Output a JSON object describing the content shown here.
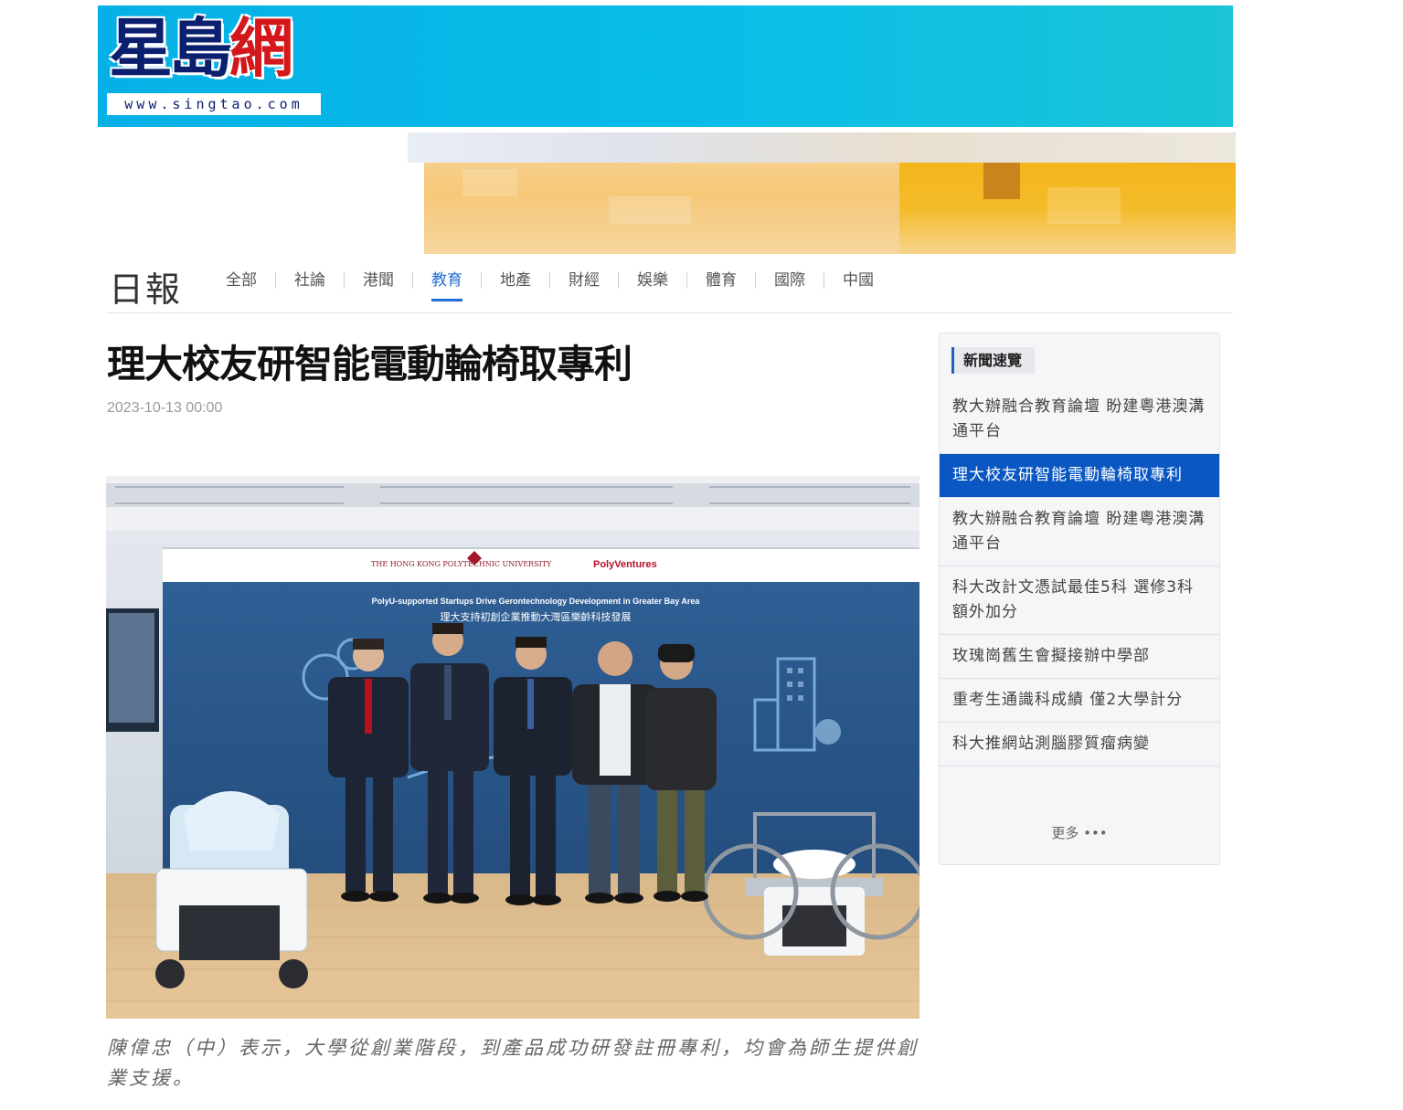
{
  "header": {
    "logo_text_1": "星島",
    "logo_text_2": "網",
    "logo_url": "www.singtao.com"
  },
  "nav": {
    "title": "日報",
    "items": [
      {
        "label": "全部",
        "active": false
      },
      {
        "label": "社論",
        "active": false
      },
      {
        "label": "港聞",
        "active": false
      },
      {
        "label": "教育",
        "active": true
      },
      {
        "label": "地產",
        "active": false
      },
      {
        "label": "財經",
        "active": false
      },
      {
        "label": "娛樂",
        "active": false
      },
      {
        "label": "體育",
        "active": false
      },
      {
        "label": "國際",
        "active": false
      },
      {
        "label": "中國",
        "active": false
      }
    ]
  },
  "article": {
    "headline": "理大校友研智能電動輪椅取專利",
    "date": "2023-10-13 00:00",
    "photo": {
      "backdrop_title_en": "PolyU-supported Startups Drive Gerontechnology Development in Greater Bay Area",
      "backdrop_title_zh": "理大支持初創企業推動大灣區樂齡科技發展",
      "backdrop_logo_1": "THE HONG KONG POLYTECHNIC UNIVERSITY",
      "backdrop_logo_2": "PolyVentures"
    },
    "caption": "陳偉忠（中）表示，大學從創業階段，到產品成功研發註冊專利，均會為師生提供創業支援。"
  },
  "sidebar": {
    "heading": "新聞速覽",
    "items": [
      {
        "text": "教大辦融合教育論壇 盼建粵港澳溝通平台",
        "active": false
      },
      {
        "text": "理大校友研智能電動輪椅取專利",
        "active": true
      },
      {
        "text": "教大辦融合教育論壇 盼建粵港澳溝通平台",
        "active": false
      },
      {
        "text": "科大改計文憑試最佳5科 選修3科額外加分",
        "active": false
      },
      {
        "text": "玫瑰崗舊生會擬接辦中學部",
        "active": false
      },
      {
        "text": "重考生通識科成績 僅2大學計分",
        "active": false
      },
      {
        "text": "科大推網站測腦膠質瘤病變",
        "active": false
      }
    ],
    "more_label": "更多 •••"
  },
  "colors": {
    "banner": "#09bde8",
    "logo_navy": "#0c1f6e",
    "logo_red": "#d3171b",
    "nav_active": "#1f6ed4",
    "sidebar_active": "#0a57c2"
  }
}
